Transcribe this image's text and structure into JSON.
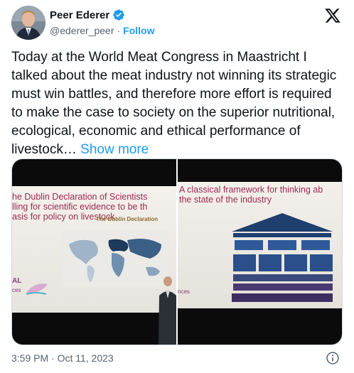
{
  "author": {
    "name": "Peer Ederer",
    "handle": "@ederer_peer",
    "separator": "·",
    "follow_label": "Follow"
  },
  "tweet": {
    "text": "Today at the World Meat Congress in Maastricht I talked about the meat industry not winning its strategic must win battles, and therefore more effort is required to make the case to society on the superior nutritional, ecological, economic and ethical performance of livestock…",
    "show_more": "Show more"
  },
  "media": {
    "left_slide": {
      "title": "he Dublin Declaration of Scientists\nlling for scientific evidence to be th\nasis for policy on livestock",
      "subtitle": "The Dublin Declaration",
      "logo_text": "AL",
      "logo_sub": "ces"
    },
    "right_slide": {
      "title": "A classical framework for thinking ab\nthe state of the industry",
      "logo_sub": "nces"
    }
  },
  "footer": {
    "timestamp": "3:59 PM · Oct 11, 2023"
  },
  "colors": {
    "accent": "#1d9bf0",
    "text": "#0f1419",
    "muted": "#536471",
    "slide_title": "#9b2a52"
  },
  "icons": {
    "verified": "verified-badge-icon",
    "brand": "x-logo-icon",
    "info": "info-icon"
  }
}
